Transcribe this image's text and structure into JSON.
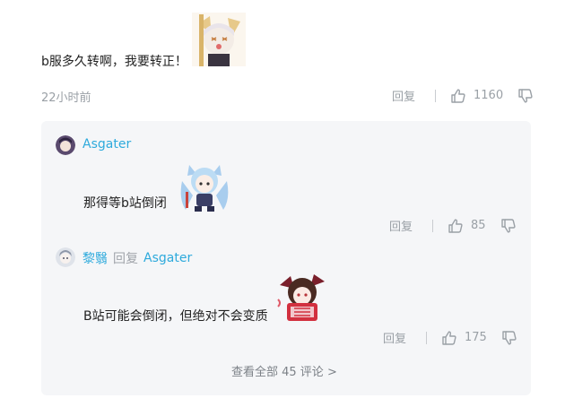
{
  "main_comment": {
    "text": "b服多久转啊，我要转正！",
    "sticker": "chibi-character-sticker",
    "time": "22小时前",
    "reply_label": "回复",
    "likes": "1160"
  },
  "replies": [
    {
      "username": "Asgater",
      "text": "那得等b站倒闭",
      "sticker": "chibi-character-sticker",
      "reply_label": "回复",
      "likes": "85"
    },
    {
      "username": "黎翳",
      "reply_word": "回复",
      "reply_to": "Asgater",
      "text": "B站可能会倒闭，但绝对不会变质",
      "sticker": "chibi-character-sticker",
      "reply_label": "回复",
      "likes": "175"
    }
  ],
  "view_all": "查看全部 45 评论 >",
  "colors": {
    "username": "#2eaadc",
    "muted": "#9aa0a6",
    "panel_bg": "#f5f6f8"
  }
}
